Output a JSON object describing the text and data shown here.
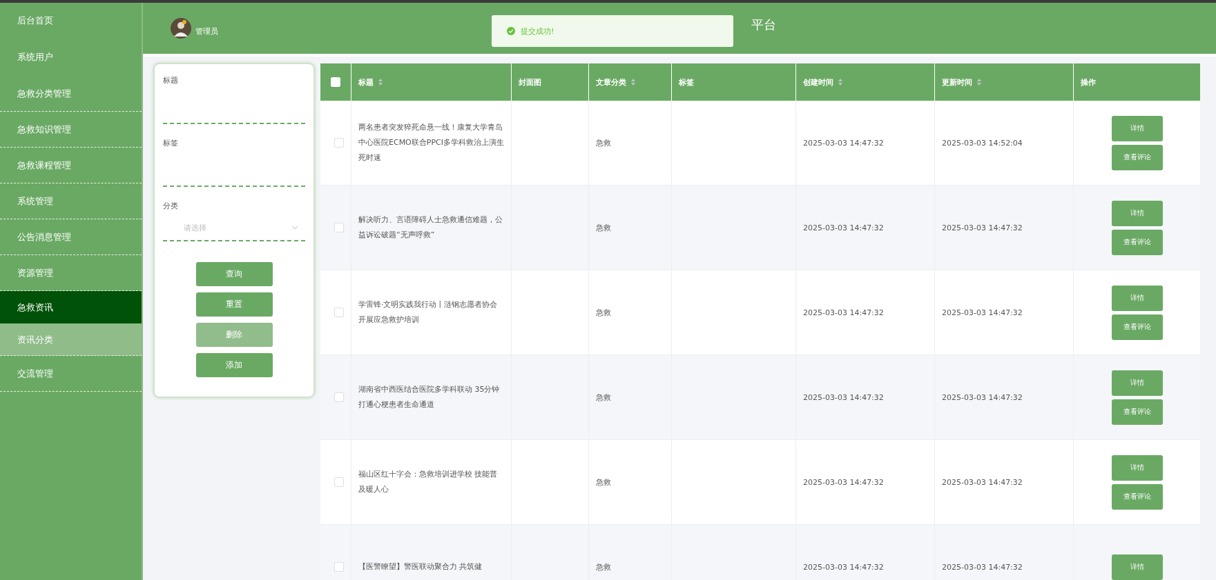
{
  "sidebar": {
    "items": [
      {
        "label": "后台首页",
        "selected": false,
        "hovered": false
      },
      {
        "label": "系统用户",
        "selected": false,
        "hovered": false
      },
      {
        "label": "急救分类管理",
        "selected": false,
        "hovered": false
      },
      {
        "label": "急救知识管理",
        "selected": false,
        "hovered": false
      },
      {
        "label": "急救课程管理",
        "selected": false,
        "hovered": false
      },
      {
        "label": "系统管理",
        "selected": false,
        "hovered": false
      },
      {
        "label": "公告消息管理",
        "selected": false,
        "hovered": false
      },
      {
        "label": "资源管理",
        "selected": false,
        "hovered": false
      },
      {
        "label": "急救资讯",
        "selected": true,
        "hovered": false
      },
      {
        "label": "资讯分类",
        "selected": false,
        "hovered": true
      },
      {
        "label": "交流管理",
        "selected": false,
        "hovered": false
      }
    ]
  },
  "header": {
    "user": "管理员",
    "title": "平台"
  },
  "toast": {
    "message": "提交成功!"
  },
  "filter": {
    "fields": [
      {
        "kind": "text",
        "label": "标题"
      },
      {
        "kind": "text",
        "label": "标签"
      },
      {
        "kind": "select",
        "label": "分类",
        "placeholder": "请选择"
      }
    ],
    "buttons": [
      {
        "label": "查询",
        "disabled": false
      },
      {
        "label": "重置",
        "disabled": false
      },
      {
        "label": "删除",
        "disabled": true
      },
      {
        "label": "添加",
        "disabled": false
      }
    ]
  },
  "table": {
    "select_all_checked": false,
    "columns": [
      {
        "label": "标题",
        "sortable": true
      },
      {
        "label": "封面图",
        "sortable": false
      },
      {
        "label": "文章分类",
        "sortable": true
      },
      {
        "label": "标签",
        "sortable": false
      },
      {
        "label": "创建时间",
        "sortable": true
      },
      {
        "label": "更新时间",
        "sortable": true
      },
      {
        "label": "操作",
        "sortable": false
      }
    ],
    "rows": [
      {
        "checked": false,
        "title": "两名患者突发猝死命悬一线！康复大学青岛中心医院ECMO联合PPCI多学科救治上演生死时速",
        "category": "急救",
        "created": "2025-03-03 14:47:32",
        "updated": "2025-03-03 14:52:04",
        "actions": [
          "详情",
          "查看评论"
        ]
      },
      {
        "checked": false,
        "title": "解决听力、言语障碍人士急救通信难题，公益诉讼破题“无声呼救”",
        "category": "急救",
        "created": "2025-03-03 14:47:32",
        "updated": "2025-03-03 14:47:32",
        "actions": [
          "详情",
          "查看评论"
        ]
      },
      {
        "checked": false,
        "title": "学雷锋·文明实践我行动丨涟钢志愿者协会开展应急救护培训",
        "category": "急救",
        "created": "2025-03-03 14:47:32",
        "updated": "2025-03-03 14:47:32",
        "actions": [
          "详情",
          "查看评论"
        ]
      },
      {
        "checked": false,
        "title": "湖南省中西医结合医院多学科联动 35分钟打通心梗患者生命通道",
        "category": "急救",
        "created": "2025-03-03 14:47:32",
        "updated": "2025-03-03 14:47:32",
        "actions": [
          "详情",
          "查看评论"
        ]
      },
      {
        "checked": false,
        "title": "福山区红十字会：急救培训进学校 技能普及暖人心",
        "category": "急救",
        "created": "2025-03-03 14:47:32",
        "updated": "2025-03-03 14:47:32",
        "actions": [
          "详情",
          "查看评论"
        ]
      },
      {
        "checked": false,
        "title": "【医警瞭望】警医联动聚合力 共筑健",
        "category": "急救",
        "created": "2025-03-03 14:47:32",
        "updated": "2025-03-03 14:47:32",
        "actions": [
          "详情"
        ]
      }
    ]
  }
}
